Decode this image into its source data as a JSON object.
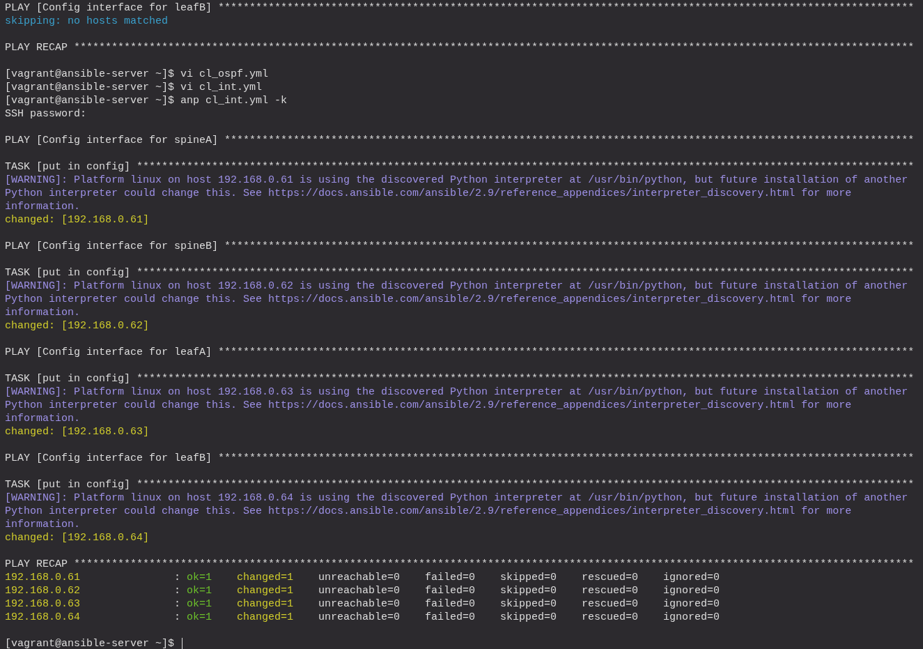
{
  "terminal": {
    "lines": [
      {
        "kind": "play",
        "text": "PLAY [Config interface for leafB] ***************************************************************************************************************"
      },
      {
        "kind": "skip",
        "text": "skipping: no hosts matched"
      },
      {
        "kind": "blank"
      },
      {
        "kind": "play",
        "text": "PLAY RECAP **************************************************************************************************************************************"
      },
      {
        "kind": "blank"
      },
      {
        "kind": "prompt",
        "text": "[vagrant@ansible-server ~]$ vi cl_ospf.yml"
      },
      {
        "kind": "prompt",
        "text": "[vagrant@ansible-server ~]$ vi cl_int.yml"
      },
      {
        "kind": "prompt",
        "text": "[vagrant@ansible-server ~]$ anp cl_int.yml -k"
      },
      {
        "kind": "plain",
        "text": "SSH password:"
      },
      {
        "kind": "blank"
      },
      {
        "kind": "play",
        "text": "PLAY [Config interface for spineA] **************************************************************************************************************"
      },
      {
        "kind": "blank"
      },
      {
        "kind": "task",
        "text": "TASK [put in config] ****************************************************************************************************************************"
      },
      {
        "kind": "warning",
        "text": "[WARNING]: Platform linux on host 192.168.0.61 is using the discovered Python interpreter at /usr/bin/python, but future installation of another"
      },
      {
        "kind": "warning",
        "text": "Python interpreter could change this. See https://docs.ansible.com/ansible/2.9/reference_appendices/interpreter_discovery.html for more"
      },
      {
        "kind": "warning",
        "text": "information."
      },
      {
        "kind": "changed",
        "text": "changed: [192.168.0.61]"
      },
      {
        "kind": "blank"
      },
      {
        "kind": "play",
        "text": "PLAY [Config interface for spineB] **************************************************************************************************************"
      },
      {
        "kind": "blank"
      },
      {
        "kind": "task",
        "text": "TASK [put in config] ****************************************************************************************************************************"
      },
      {
        "kind": "warning",
        "text": "[WARNING]: Platform linux on host 192.168.0.62 is using the discovered Python interpreter at /usr/bin/python, but future installation of another"
      },
      {
        "kind": "warning",
        "text": "Python interpreter could change this. See https://docs.ansible.com/ansible/2.9/reference_appendices/interpreter_discovery.html for more"
      },
      {
        "kind": "warning",
        "text": "information."
      },
      {
        "kind": "changed",
        "text": "changed: [192.168.0.62]"
      },
      {
        "kind": "blank"
      },
      {
        "kind": "play",
        "text": "PLAY [Config interface for leafA] ***************************************************************************************************************"
      },
      {
        "kind": "blank"
      },
      {
        "kind": "task",
        "text": "TASK [put in config] ****************************************************************************************************************************"
      },
      {
        "kind": "warning",
        "text": "[WARNING]: Platform linux on host 192.168.0.63 is using the discovered Python interpreter at /usr/bin/python, but future installation of another"
      },
      {
        "kind": "warning",
        "text": "Python interpreter could change this. See https://docs.ansible.com/ansible/2.9/reference_appendices/interpreter_discovery.html for more"
      },
      {
        "kind": "warning",
        "text": "information."
      },
      {
        "kind": "changed",
        "text": "changed: [192.168.0.63]"
      },
      {
        "kind": "blank"
      },
      {
        "kind": "play",
        "text": "PLAY [Config interface for leafB] ***************************************************************************************************************"
      },
      {
        "kind": "blank"
      },
      {
        "kind": "task",
        "text": "TASK [put in config] ****************************************************************************************************************************"
      },
      {
        "kind": "warning",
        "text": "[WARNING]: Platform linux on host 192.168.0.64 is using the discovered Python interpreter at /usr/bin/python, but future installation of another"
      },
      {
        "kind": "warning",
        "text": "Python interpreter could change this. See https://docs.ansible.com/ansible/2.9/reference_appendices/interpreter_discovery.html for more"
      },
      {
        "kind": "warning",
        "text": "information."
      },
      {
        "kind": "changed",
        "text": "changed: [192.168.0.64]"
      },
      {
        "kind": "blank"
      },
      {
        "kind": "play",
        "text": "PLAY RECAP **************************************************************************************************************************************"
      },
      {
        "kind": "recap",
        "host": "192.168.0.61",
        "colon": ":",
        "stats": [
          {
            "text": "ok=1",
            "kind": "ok"
          },
          {
            "text": "changed=1",
            "kind": "changed"
          },
          {
            "text": "unreachable=0",
            "kind": "plain"
          },
          {
            "text": "failed=0",
            "kind": "plain"
          },
          {
            "text": "skipped=0",
            "kind": "plain"
          },
          {
            "text": "rescued=0",
            "kind": "plain"
          },
          {
            "text": "ignored=0",
            "kind": "plain"
          }
        ]
      },
      {
        "kind": "recap",
        "host": "192.168.0.62",
        "colon": ":",
        "stats": [
          {
            "text": "ok=1",
            "kind": "ok"
          },
          {
            "text": "changed=1",
            "kind": "changed"
          },
          {
            "text": "unreachable=0",
            "kind": "plain"
          },
          {
            "text": "failed=0",
            "kind": "plain"
          },
          {
            "text": "skipped=0",
            "kind": "plain"
          },
          {
            "text": "rescued=0",
            "kind": "plain"
          },
          {
            "text": "ignored=0",
            "kind": "plain"
          }
        ]
      },
      {
        "kind": "recap",
        "host": "192.168.0.63",
        "colon": ":",
        "stats": [
          {
            "text": "ok=1",
            "kind": "ok"
          },
          {
            "text": "changed=1",
            "kind": "changed"
          },
          {
            "text": "unreachable=0",
            "kind": "plain"
          },
          {
            "text": "failed=0",
            "kind": "plain"
          },
          {
            "text": "skipped=0",
            "kind": "plain"
          },
          {
            "text": "rescued=0",
            "kind": "plain"
          },
          {
            "text": "ignored=0",
            "kind": "plain"
          }
        ]
      },
      {
        "kind": "recap",
        "host": "192.168.0.64",
        "colon": ":",
        "stats": [
          {
            "text": "ok=1",
            "kind": "ok"
          },
          {
            "text": "changed=1",
            "kind": "changed"
          },
          {
            "text": "unreachable=0",
            "kind": "plain"
          },
          {
            "text": "failed=0",
            "kind": "plain"
          },
          {
            "text": "skipped=0",
            "kind": "plain"
          },
          {
            "text": "rescued=0",
            "kind": "plain"
          },
          {
            "text": "ignored=0",
            "kind": "plain"
          }
        ]
      },
      {
        "kind": "blank"
      },
      {
        "kind": "prompt",
        "text": "[vagrant@ansible-server ~]$ ",
        "cursor": true
      }
    ]
  }
}
